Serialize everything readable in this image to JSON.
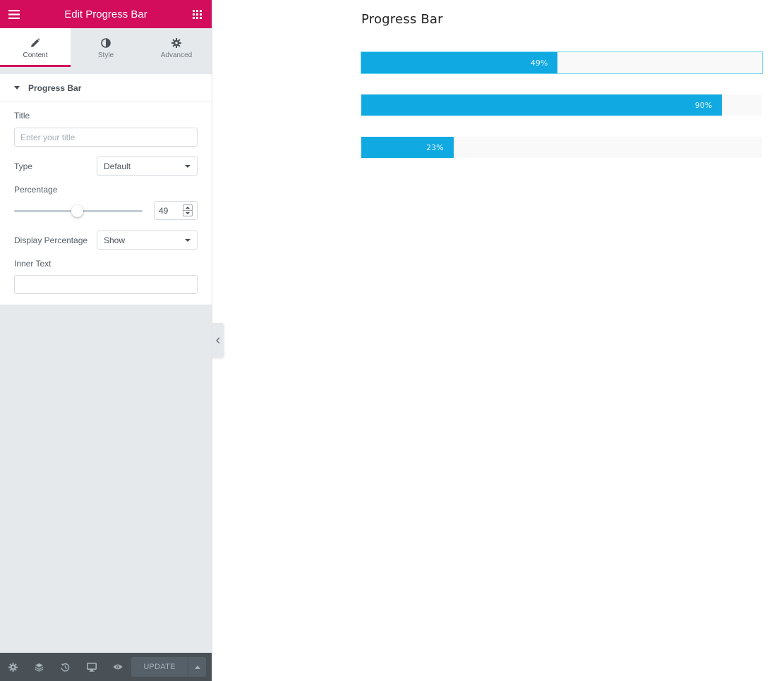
{
  "panel": {
    "header_title": "Edit Progress Bar",
    "tabs": [
      {
        "label": "Content",
        "icon": "pencil-icon",
        "active": true
      },
      {
        "label": "Style",
        "icon": "half-circle-icon",
        "active": false
      },
      {
        "label": "Advanced",
        "icon": "gear-icon",
        "active": false
      }
    ],
    "section_title": "Progress Bar",
    "controls": {
      "title_label": "Title",
      "title_placeholder": "Enter your title",
      "title_value": "",
      "type_label": "Type",
      "type_value": "Default",
      "percentage_label": "Percentage",
      "percentage_value": "49",
      "percentage_fraction": 0.49,
      "display_label": "Display Percentage",
      "display_value": "Show",
      "inner_text_label": "Inner Text",
      "inner_text_value": ""
    },
    "footer": {
      "icons": [
        "settings-gear-icon",
        "layers-icon",
        "history-icon",
        "responsive-desktop-icon",
        "preview-eye-icon"
      ],
      "update_label": "UPDATE"
    }
  },
  "preview": {
    "title": "Progress Bar",
    "bars": [
      {
        "label": "49%",
        "percent": 49
      },
      {
        "label": "90%",
        "percent": 90
      },
      {
        "label": "23%",
        "percent": 23
      }
    ],
    "bar_color": "#10a9e1"
  },
  "colors": {
    "accent": "#d30c5c",
    "panel_bg": "#e6e9ec",
    "footer_bg": "#495157"
  }
}
